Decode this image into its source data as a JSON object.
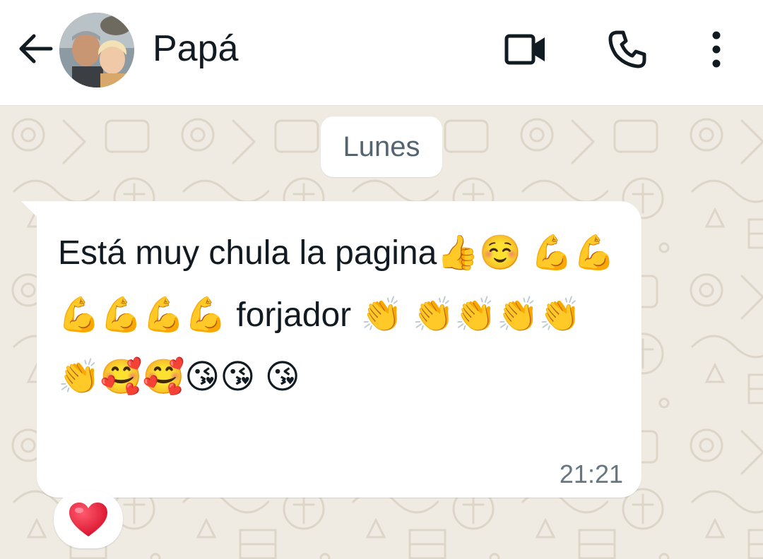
{
  "header": {
    "contact_name": "Papá",
    "icons": [
      "back-arrow-icon",
      "video-call-icon",
      "phone-icon",
      "more-vert-icon"
    ]
  },
  "chat": {
    "date_label": "Lunes",
    "messages": [
      {
        "text": "Está muy chula la pagina👍☺️ 💪💪💪💪💪💪 forjador 👏 👏👏👏👏👏🥰🥰😘😘 😘",
        "time": "21:21",
        "reaction": "❤️"
      }
    ]
  },
  "colors": {
    "header_bg": "#ffffff",
    "chat_bg": "#efeae2",
    "bubble_bg": "#ffffff",
    "text": "#111b21",
    "meta_text": "#667781"
  }
}
